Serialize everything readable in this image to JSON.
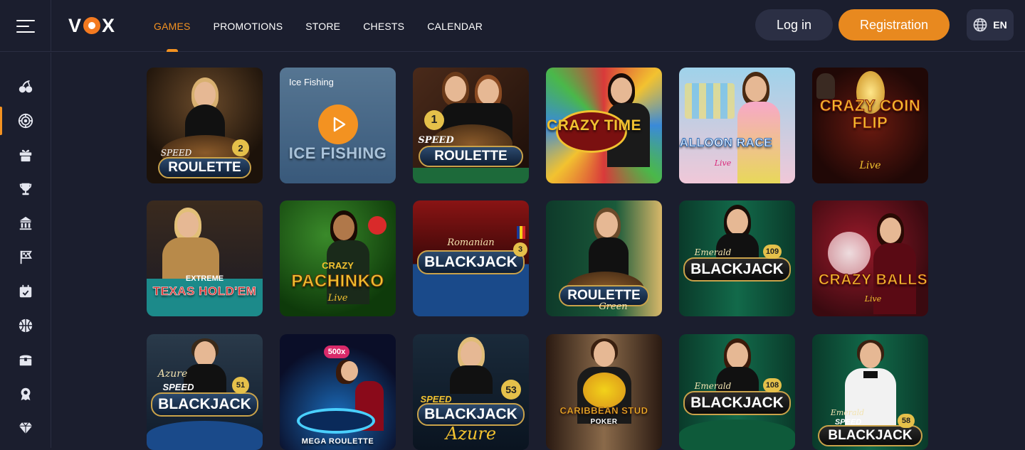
{
  "brand": {
    "logo_text_left": "V",
    "logo_text_right": "X",
    "accent": "#f39221"
  },
  "nav": {
    "items": [
      {
        "label": "GAMES",
        "active": true
      },
      {
        "label": "PROMOTIONS"
      },
      {
        "label": "STORE"
      },
      {
        "label": "CHESTS"
      },
      {
        "label": "CALENDAR"
      }
    ]
  },
  "header": {
    "login_label": "Log in",
    "register_label": "Registration",
    "lang_label": "EN"
  },
  "sidebar": {
    "items": [
      {
        "icon": "cherries-icon"
      },
      {
        "icon": "roulette-icon",
        "active": true
      },
      {
        "icon": "gift-icon"
      },
      {
        "icon": "trophy-icon"
      },
      {
        "icon": "store-icon"
      },
      {
        "icon": "flag-icon"
      },
      {
        "icon": "calendar-icon"
      },
      {
        "icon": "sports-ball-icon"
      },
      {
        "icon": "chest-icon"
      },
      {
        "icon": "badge-icon"
      },
      {
        "icon": "diamond-icon"
      }
    ]
  },
  "games": {
    "row1": [
      {
        "title": "ROULETTE",
        "sub": "SPEED",
        "num": "2"
      },
      {
        "title": "ICE FISHING",
        "hover_label": "Ice Fishing"
      },
      {
        "title": "ROULETTE",
        "sub": "SPEED",
        "num": "1"
      },
      {
        "title": "CRAZY TIME"
      },
      {
        "title": "BALLOON RACE",
        "sub": "Live"
      },
      {
        "title": "CRAZY COIN FLIP",
        "sub": "Live"
      }
    ],
    "row2": [
      {
        "title": "TEXAS HOLD'EM",
        "sub": "EXTREME"
      },
      {
        "title": "PACHINKO",
        "sub": "CRAZY",
        "sub2": "Live"
      },
      {
        "title": "BLACKJACK",
        "sub": "Romanian",
        "num": "3"
      },
      {
        "title": "ROULETTE",
        "sub": "Green"
      },
      {
        "title": "BLACKJACK",
        "sub": "Emerald",
        "num": "109"
      },
      {
        "title": "CRAZY BALLS",
        "sub": "Live"
      }
    ],
    "row3": [
      {
        "title": "BLACKJACK",
        "sub": "SPEED",
        "sub2": "Azure",
        "num": "51"
      },
      {
        "title": "MEGA ROULETTE",
        "sub": "500x"
      },
      {
        "title": "BLACKJACK",
        "sub": "SPEED",
        "sub2": "Azure",
        "num": "53"
      },
      {
        "title": "CARIBBEAN STUD",
        "sub": "POKER"
      },
      {
        "title": "BLACKJACK",
        "sub": "Emerald",
        "num": "108"
      },
      {
        "title": "BLACKJACK",
        "sub": "SPEED",
        "sub2": "Emerald",
        "num": "58"
      }
    ]
  }
}
